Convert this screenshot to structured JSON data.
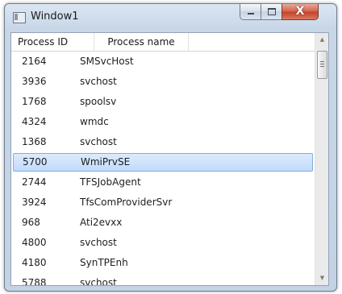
{
  "window": {
    "title": "Window1",
    "controls": {
      "minimize": "minimize",
      "maximize": "maximize",
      "close": "X"
    }
  },
  "columns": [
    "Process ID",
    "Process name"
  ],
  "rows": [
    {
      "id": "2164",
      "name": "SMSvcHost"
    },
    {
      "id": "3936",
      "name": "svchost"
    },
    {
      "id": "1768",
      "name": "spoolsv"
    },
    {
      "id": "4324",
      "name": "wmdc"
    },
    {
      "id": "1368",
      "name": "svchost"
    },
    {
      "id": "5700",
      "name": "WmiPrvSE"
    },
    {
      "id": "2744",
      "name": "TFSJobAgent"
    },
    {
      "id": "3924",
      "name": "TfsComProviderSvr"
    },
    {
      "id": "968",
      "name": "Ati2evxx"
    },
    {
      "id": "4800",
      "name": "svchost"
    },
    {
      "id": "4180",
      "name": "SynTPEnh"
    },
    {
      "id": "5788",
      "name": "svchost"
    }
  ],
  "selected_index": 5,
  "colors": {
    "selection_fill": "#c8dffc",
    "selection_border": "#84acdd",
    "close_button": "#c44128"
  }
}
